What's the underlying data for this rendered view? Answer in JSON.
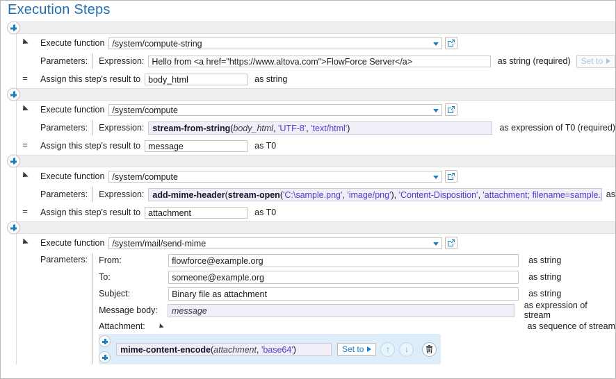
{
  "page": {
    "title": "Execution Steps"
  },
  "labels": {
    "execute_function": "Execute function",
    "parameters": "Parameters:",
    "expression": "Expression:",
    "assign_result": "Assign this step's result to",
    "set_to": "Set to",
    "add_step_icon": "plus-icon",
    "open_icon": "open-external-icon",
    "dropdown_icon": "chevron-down-icon",
    "move_up_icon": "arrow-up-icon",
    "move_down_icon": "arrow-down-icon",
    "delete_icon": "trash-icon"
  },
  "colors": {
    "title": "#1f6fb2",
    "accent": "#1680c4",
    "expression_bg": "#f1eef8",
    "expression_border": "#cdc7e0",
    "string_literal": "#4d3fcf",
    "selected_row_bg": "#ddeefa",
    "band_bg": "#eeeeee"
  },
  "steps": [
    {
      "function": "/system/compute-string",
      "param_label": "Expression:",
      "expression": {
        "plain": "Hello from <a href=\"https://www.altova.com\">FlowForce Server</a>",
        "styled": false
      },
      "type_note": "as string (required)",
      "set_to": "Set to",
      "set_to_enabled": false,
      "assign_to": "body_html",
      "assign_type": "as string"
    },
    {
      "function": "/system/compute",
      "param_label": "Expression:",
      "expression": {
        "tokens": [
          {
            "t": "stream-from-string",
            "k": "fn"
          },
          {
            "t": "(",
            "k": "pl"
          },
          {
            "t": "body_html",
            "k": "var"
          },
          {
            "t": ", ",
            "k": "pl"
          },
          {
            "t": "'UTF-8'",
            "k": "str"
          },
          {
            "t": ", ",
            "k": "pl"
          },
          {
            "t": "'text/html'",
            "k": "str"
          },
          {
            "t": ")",
            "k": "pl"
          }
        ]
      },
      "type_note": "as expression of T0 (required)",
      "assign_to": "message",
      "assign_type": "as T0"
    },
    {
      "function": "/system/compute",
      "param_label": "Expression:",
      "expression": {
        "tokens": [
          {
            "t": "add-mime-header",
            "k": "fn"
          },
          {
            "t": "(",
            "k": "pl"
          },
          {
            "t": "stream-open",
            "k": "fn"
          },
          {
            "t": "(",
            "k": "pl"
          },
          {
            "t": "'C:\\sample.png'",
            "k": "str"
          },
          {
            "t": ", ",
            "k": "pl"
          },
          {
            "t": "'image/png'",
            "k": "str"
          },
          {
            "t": ")",
            "k": "pl"
          },
          {
            "t": ", ",
            "k": "pl"
          },
          {
            "t": "'Content-Disposition'",
            "k": "str"
          },
          {
            "t": ", ",
            "k": "pl"
          },
          {
            "t": "'attachment; filename=sample.png'",
            "k": "str"
          },
          {
            "t": ")",
            "k": "pl"
          }
        ]
      },
      "type_note": "as",
      "assign_to": "attachment",
      "assign_type": "as T0"
    }
  ],
  "mail_step": {
    "function": "/system/mail/send-mime",
    "parameters_label": "Parameters:",
    "fields": [
      {
        "name": "From:",
        "value": "flowforce@example.org",
        "type_note": "as string",
        "expr": false
      },
      {
        "name": "To:",
        "value": "someone@example.org",
        "type_note": "as string",
        "expr": false
      },
      {
        "name": "Subject:",
        "value": "Binary file as attachment",
        "type_note": "as string",
        "expr": false
      },
      {
        "name": "Message body:",
        "value": "message",
        "type_note": "as expression of stream",
        "expr": true
      }
    ],
    "attachment": {
      "name": "Attachment:",
      "type_note": "as sequence of stream",
      "set_to": "Set to",
      "expression_tokens": [
        {
          "t": "mime-content-encode",
          "k": "fn"
        },
        {
          "t": "(",
          "k": "pl"
        },
        {
          "t": "attachment",
          "k": "var"
        },
        {
          "t": ", ",
          "k": "pl"
        },
        {
          "t": "'base64'",
          "k": "str"
        },
        {
          "t": ")",
          "k": "pl"
        }
      ]
    }
  }
}
